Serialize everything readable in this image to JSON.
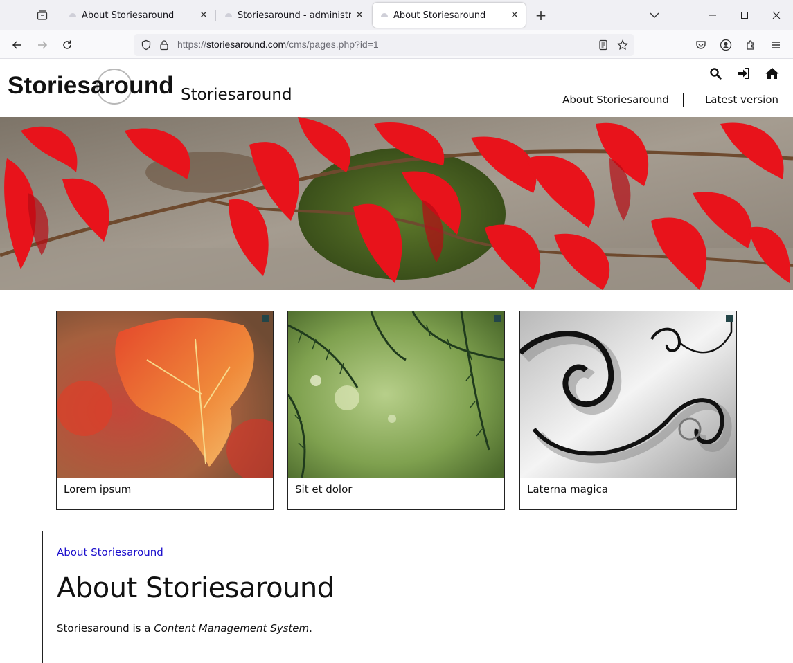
{
  "browser": {
    "tabs": [
      {
        "title": "About Storiesaround",
        "active": false
      },
      {
        "title": "Storiesaround - administration",
        "active": false
      },
      {
        "title": "About Storiesaround",
        "active": true
      }
    ],
    "url_prefix": "https://",
    "url_host": "storiesaround.com",
    "url_path": "/cms/pages.php?id=1"
  },
  "site": {
    "logo_text": "Storiesaround",
    "name": "Storiesaround",
    "nav": [
      "About Storiesaround",
      "Latest version"
    ],
    "icons": [
      "search-icon",
      "login-icon",
      "home-icon"
    ]
  },
  "cards": [
    {
      "label": "Lorem ipsum"
    },
    {
      "label": "Sit et dolor"
    },
    {
      "label": "Laterna magica"
    }
  ],
  "content": {
    "breadcrumb": "About Storiesaround",
    "title": "About Storiesaround",
    "intro_prefix": "Storiesaround is a ",
    "intro_em": "Content Management System",
    "intro_suffix": "."
  }
}
